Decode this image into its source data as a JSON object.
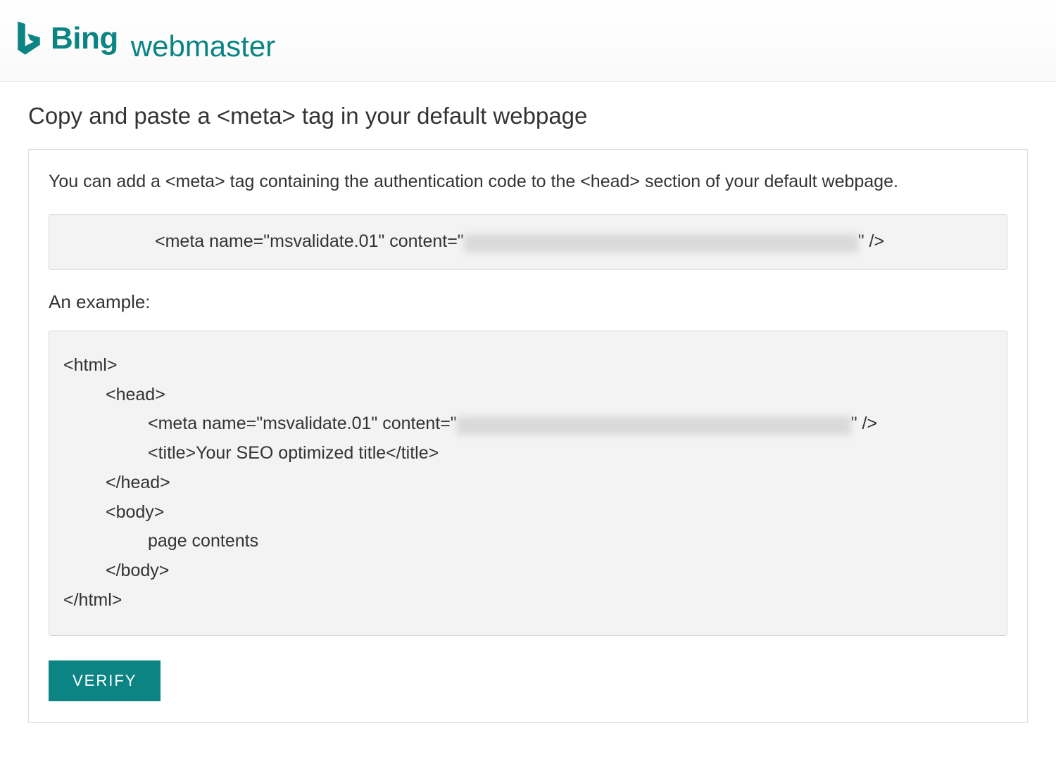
{
  "header": {
    "brand": "Bing",
    "product": "webmaster"
  },
  "page": {
    "heading": "Copy and paste a <meta> tag in your default webpage",
    "intro": "You can add a <meta> tag containing the authentication code to the <head> section of your default webpage.",
    "meta_prefix": "<meta name=\"msvalidate.01\" content=\"",
    "meta_suffix": "\" />",
    "example_label": "An example:",
    "example": {
      "l1": "<html>",
      "l2": "<head>",
      "l3_prefix": "<meta name=\"msvalidate.01\" content=\"",
      "l3_suffix": "\" />",
      "l4": "<title>Your SEO optimized title</title>",
      "l5": "</head>",
      "l6": "<body>",
      "l7": "page contents",
      "l8": "</body>",
      "l9": "</html>"
    },
    "verify_label": "VERIFY"
  },
  "colors": {
    "accent": "#0c8484"
  }
}
